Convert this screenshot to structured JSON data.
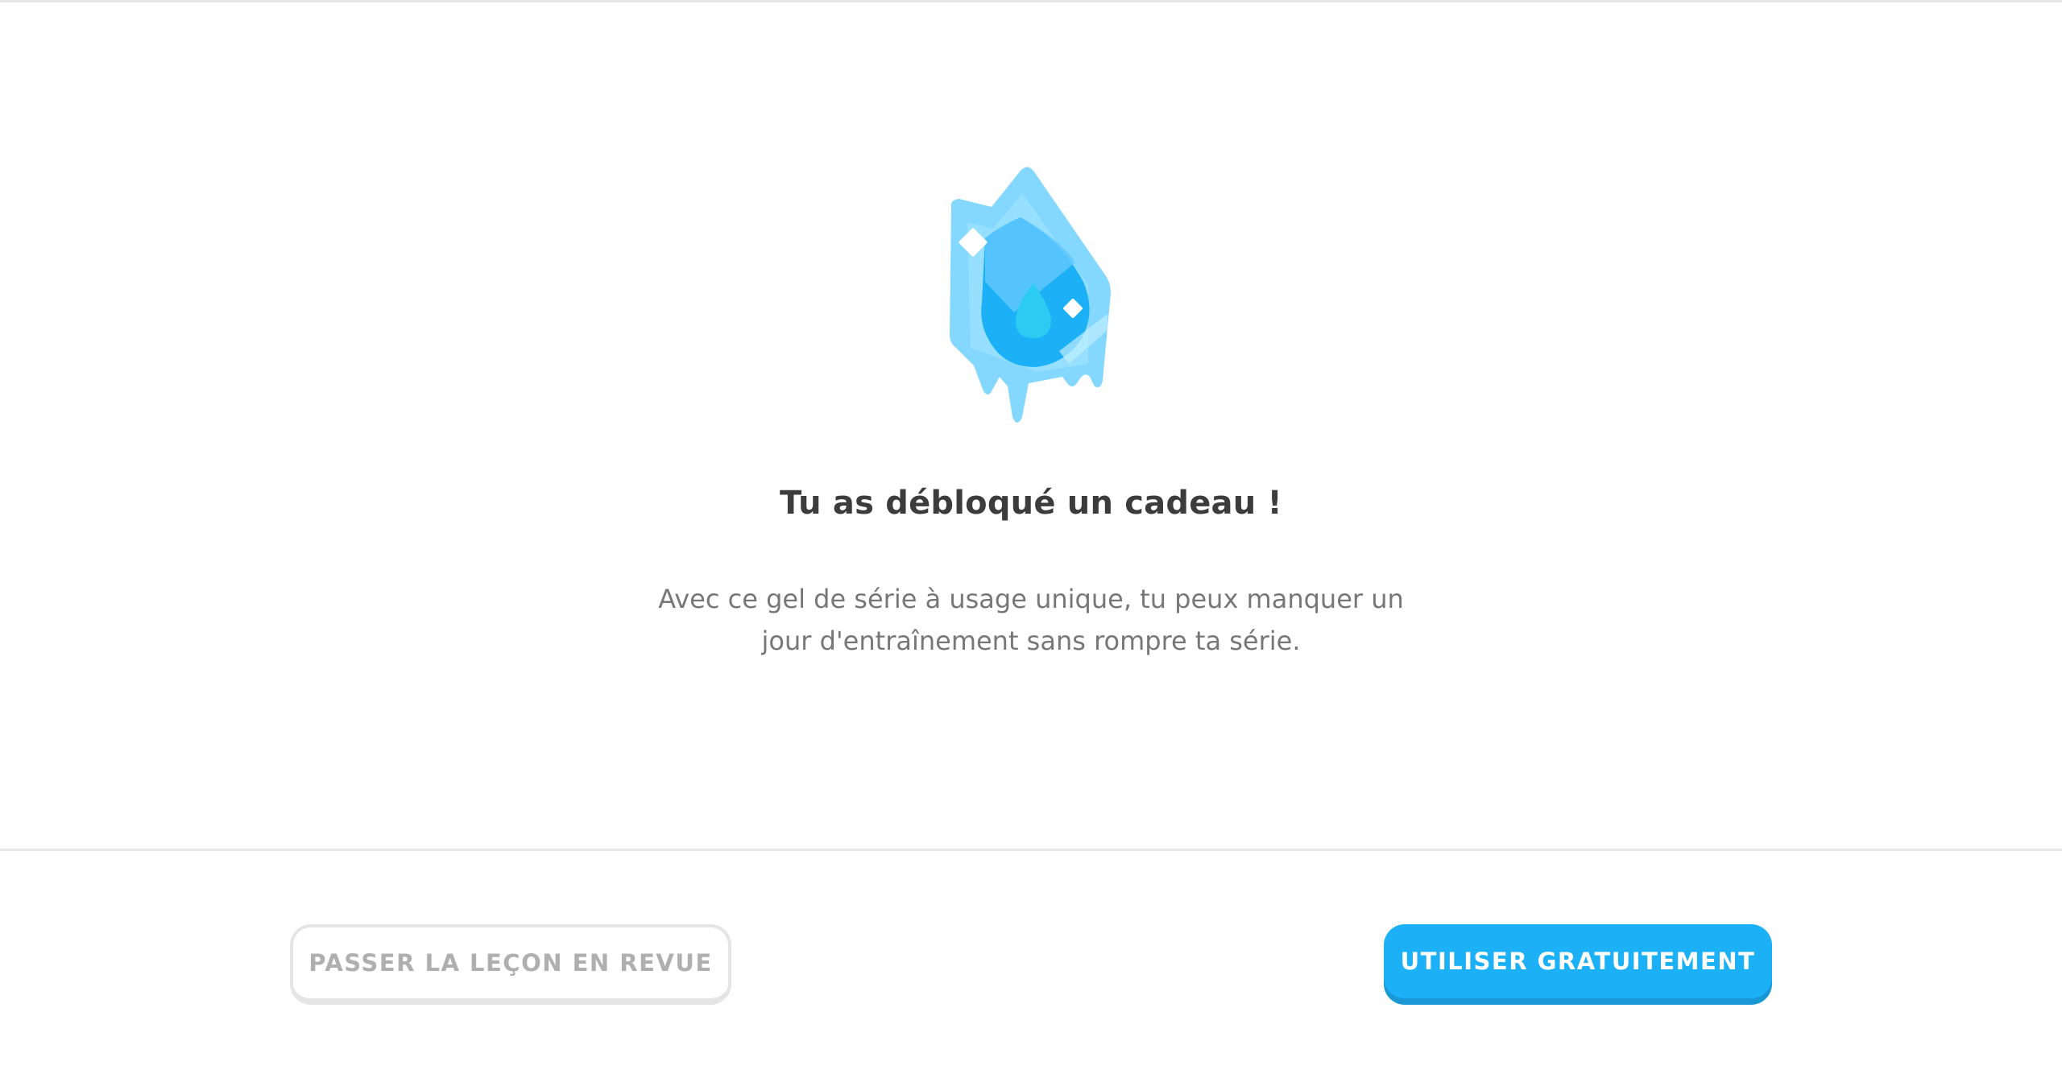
{
  "gift": {
    "illustration_icon": "streak-freeze-ice-icon",
    "title": "Tu as débloqué un cadeau !",
    "description": "Avec ce gel de série à usage unique, tu peux manquer un jour d'entraînement sans rompre ta série."
  },
  "footer": {
    "review_button_label": "PASSER LA LEÇON EN REVUE",
    "use_free_button_label": "UTILISER GRATUITEMENT"
  },
  "colors": {
    "primary_button": "#1cb0f6",
    "primary_button_shadow": "#1899d6",
    "ice_light": "#84d8ff",
    "ice_dark": "#1cb0f6",
    "title_text": "#3c3c3c",
    "body_text": "#777777"
  }
}
